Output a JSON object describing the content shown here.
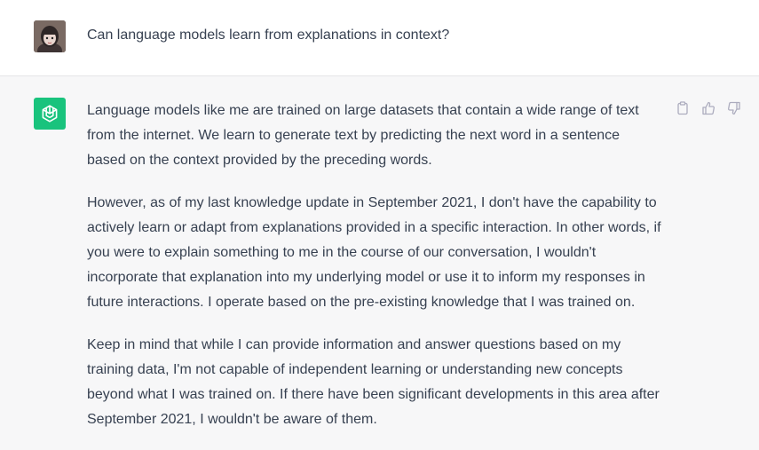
{
  "conversation": {
    "user_message": "Can language models learn from explanations in context?",
    "assistant_paragraphs": [
      "Language models like me are trained on large datasets that contain a wide range of text from the internet. We learn to generate text by predicting the next word in a sentence based on the context provided by the preceding words.",
      "However, as of my last knowledge update in September 2021, I don't have the capability to actively learn or adapt from explanations provided in a specific interaction. In other words, if you were to explain something to me in the course of our conversation, I wouldn't incorporate that explanation into my underlying model or use it to inform my responses in future interactions. I operate based on the pre-existing knowledge that I was trained on.",
      "Keep in mind that while I can provide information and answer questions based on my training data, I'm not capable of independent learning or understanding new concepts beyond what I was trained on. If there have been significant developments in this area after September 2021, I wouldn't be aware of them."
    ]
  },
  "icons": {
    "avatar": "user-avatar",
    "assistant": "openai-logo-icon",
    "copy": "clipboard-icon",
    "like": "thumbs-up-icon",
    "dislike": "thumbs-down-icon"
  },
  "colors": {
    "assistant_logo_bg": "#19c37d",
    "assistant_row_bg": "#f7f7f8",
    "user_row_bg": "#ffffff",
    "text": "#374151",
    "icon": "#acacbe"
  }
}
